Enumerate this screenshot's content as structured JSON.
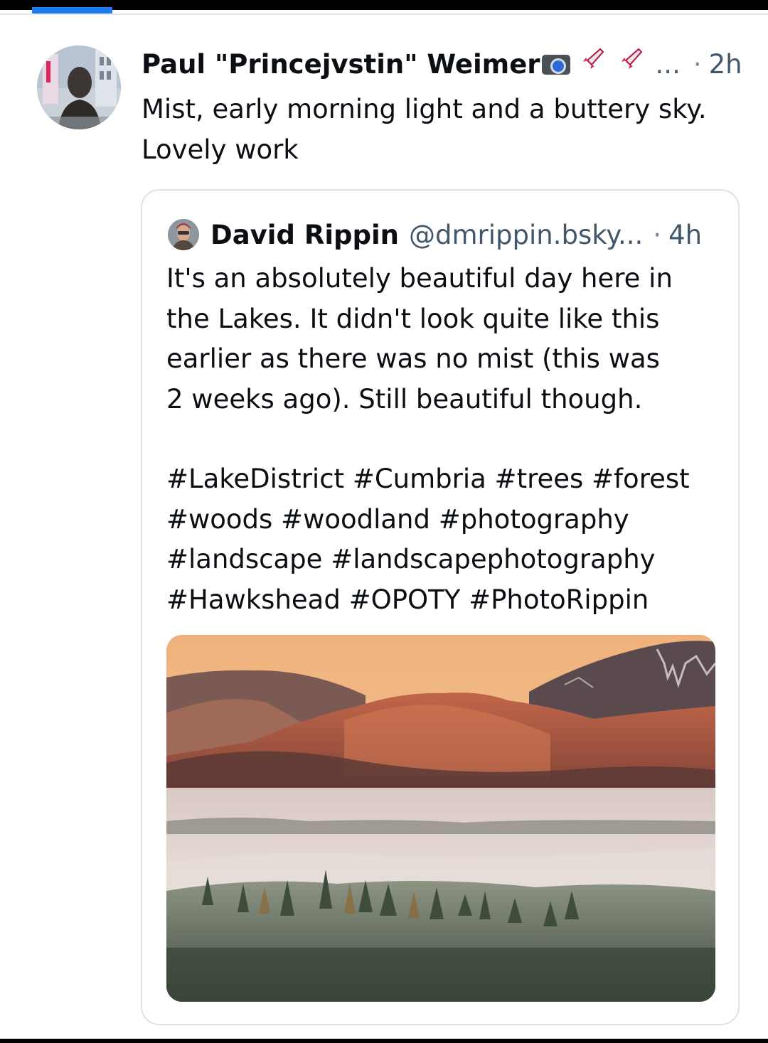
{
  "colors": {
    "accent": "#1d7cf2",
    "text_primary": "#0b0f14",
    "text_secondary": "#42576c",
    "border": "#dbe2ea"
  },
  "post": {
    "author": {
      "display_name": "Paul \"Princejvstin\" Weimer",
      "badges": [
        "camera-icon",
        "rocket-icon",
        "rocket-icon"
      ],
      "ellipsis": "...",
      "avatar": "avatar-statue-photo"
    },
    "separator": "·",
    "time": "2h",
    "text": "Mist, early morning light and a buttery sky. Lovely work"
  },
  "quote": {
    "author": {
      "display_name": "David Rippin",
      "handle": "@dmrippin.bsky...",
      "avatar": "avatar-photo"
    },
    "separator": "·",
    "time": "4h",
    "text": "It's an absolutely beautiful day here in\nthe Lakes. It didn't look quite like this\nearlier as there was no mist (this was\n2 weeks ago). Still beautiful though.",
    "hashtags": "#LakeDistrict #Cumbria #trees #forest\n#woods #woodland #photography\n#landscape #landscapephotography\n#Hawkshead #OPOTY #PhotoRippin",
    "image": "misty-lake-district-landscape-photo"
  }
}
